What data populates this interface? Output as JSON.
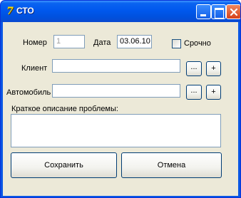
{
  "window": {
    "title": "СТО",
    "app_icon_glyph": "7"
  },
  "form": {
    "number_label": "Номер",
    "number_value": "1",
    "date_label": "Дата",
    "date_value": "03.06.10",
    "urgent_label": "Срочно",
    "urgent_checked": false,
    "client_label": "Клиент",
    "client_value": "",
    "client_browse_label": "...",
    "client_add_label": "+",
    "car_label": "Автомобиль",
    "car_value": "",
    "car_browse_label": "...",
    "car_add_label": "+",
    "problem_label": "Краткое описание проблемы:",
    "problem_value": ""
  },
  "actions": {
    "save_label": "Сохранить",
    "cancel_label": "Отмена"
  },
  "colors": {
    "titlebar": "#0058ee",
    "client_area": "#ece9d8",
    "close_button": "#d6411a"
  },
  "icons": [
    "app-icon",
    "minimize-icon",
    "maximize-icon",
    "close-icon"
  ]
}
